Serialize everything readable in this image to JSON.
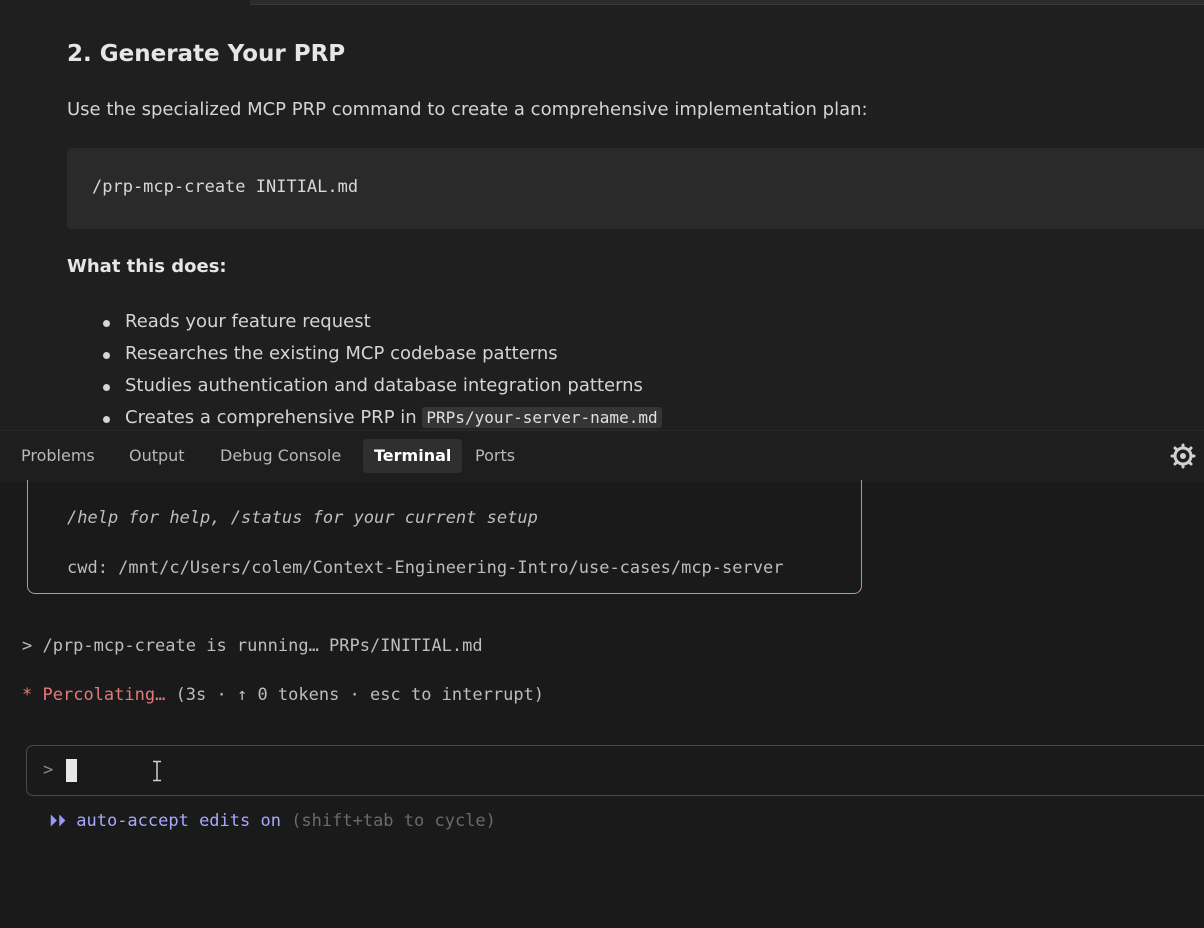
{
  "preview": {
    "heading": "2. Generate Your PRP",
    "intro": "Use the specialized MCP PRP command to create a comprehensive implementation plan:",
    "code": "/prp-mcp-create INITIAL.md",
    "what_heading": "What this does:",
    "bullets": [
      "Reads your feature request",
      "Researches the existing MCP codebase patterns",
      "Studies authentication and database integration patterns",
      "Creates a comprehensive PRP in "
    ],
    "bullet_code": "PRPs/your-server-name.md"
  },
  "panel": {
    "tabs": [
      {
        "label": "Problems",
        "active": false
      },
      {
        "label": "Output",
        "active": false
      },
      {
        "label": "Debug Console",
        "active": false
      },
      {
        "label": "Terminal",
        "active": true
      },
      {
        "label": "Ports",
        "active": false
      }
    ],
    "icon": "gear-icon"
  },
  "terminal": {
    "help_line": "/help for help, /status for your current setup",
    "cwd_line": "cwd: /mnt/c/Users/colem/Context-Engineering-Intro/use-cases/mcp-server",
    "running_line": "> /prp-mcp-create is running… PRPs/INITIAL.md",
    "status_symbol": "*",
    "status_word": "Percolating…",
    "status_detail": " (3s · ↑ 0 tokens · esc to interrupt)",
    "prompt_symbol": ">",
    "mode_icon": "⏵⏵",
    "mode_text": "auto-accept edits on",
    "mode_hint": " (shift+tab to cycle)"
  },
  "colors": {
    "accent_red": "#e27a7a",
    "mode_purple": "#a8a8ff",
    "box_border": "#d58a8a"
  }
}
